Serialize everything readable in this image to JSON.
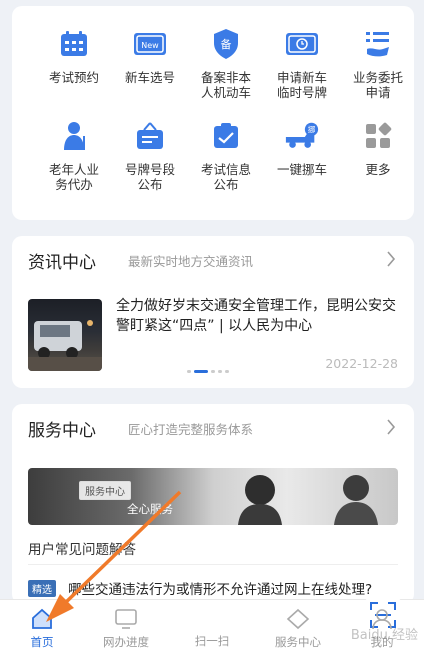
{
  "services": [
    {
      "label": "考试预约",
      "icon": "calendar-icon"
    },
    {
      "label": "新车选号",
      "icon": "new-plate-icon"
    },
    {
      "label": "备案非本\n人机动车",
      "icon": "shield-record-icon"
    },
    {
      "label": "申请新车\n临时号牌",
      "icon": "temp-plate-icon"
    },
    {
      "label": "业务委托\n申请",
      "icon": "delegate-list-icon"
    },
    {
      "label": "老年人业\n务代办",
      "icon": "elderly-person-icon"
    },
    {
      "label": "号牌号段\n公布",
      "icon": "plate-board-icon"
    },
    {
      "label": "考试信息\n公布",
      "icon": "exam-info-icon"
    },
    {
      "label": "一键挪车",
      "icon": "move-car-icon"
    },
    {
      "label": "更多",
      "icon": "more-grid-icon"
    }
  ],
  "news": {
    "title": "资讯中心",
    "subtitle": "最新实时地方交通资讯",
    "headline": "全力做好岁末交通安全管理工作，昆明公安交警盯紧这“四点” | 以人民为中心",
    "date": "2022-12-28"
  },
  "service_center": {
    "title": "服务中心",
    "subtitle": "匠心打造完整服务体系",
    "banner_tag": "服务中心",
    "banner_text": "全心服务",
    "faq_title": "用户常见问题解答",
    "faq_tag": "精选",
    "faq_question": "哪些交通违法行为或情形不允许通过网上在线处理?"
  },
  "tabbar": [
    {
      "label": "首页",
      "icon": "home-icon",
      "active": true
    },
    {
      "label": "网办进度",
      "icon": "monitor-icon",
      "active": false
    },
    {
      "label": "扫一扫",
      "icon": "scan-icon",
      "active": false
    },
    {
      "label": "服务中心",
      "icon": "diamond-icon",
      "active": false
    },
    {
      "label": "我的",
      "icon": "user-icon",
      "active": false
    }
  ],
  "watermark": "Baidu 经验",
  "colors": {
    "accent": "#2a6edb",
    "icon_blue": "#3b7be6",
    "arrow": "#f07a2a"
  }
}
